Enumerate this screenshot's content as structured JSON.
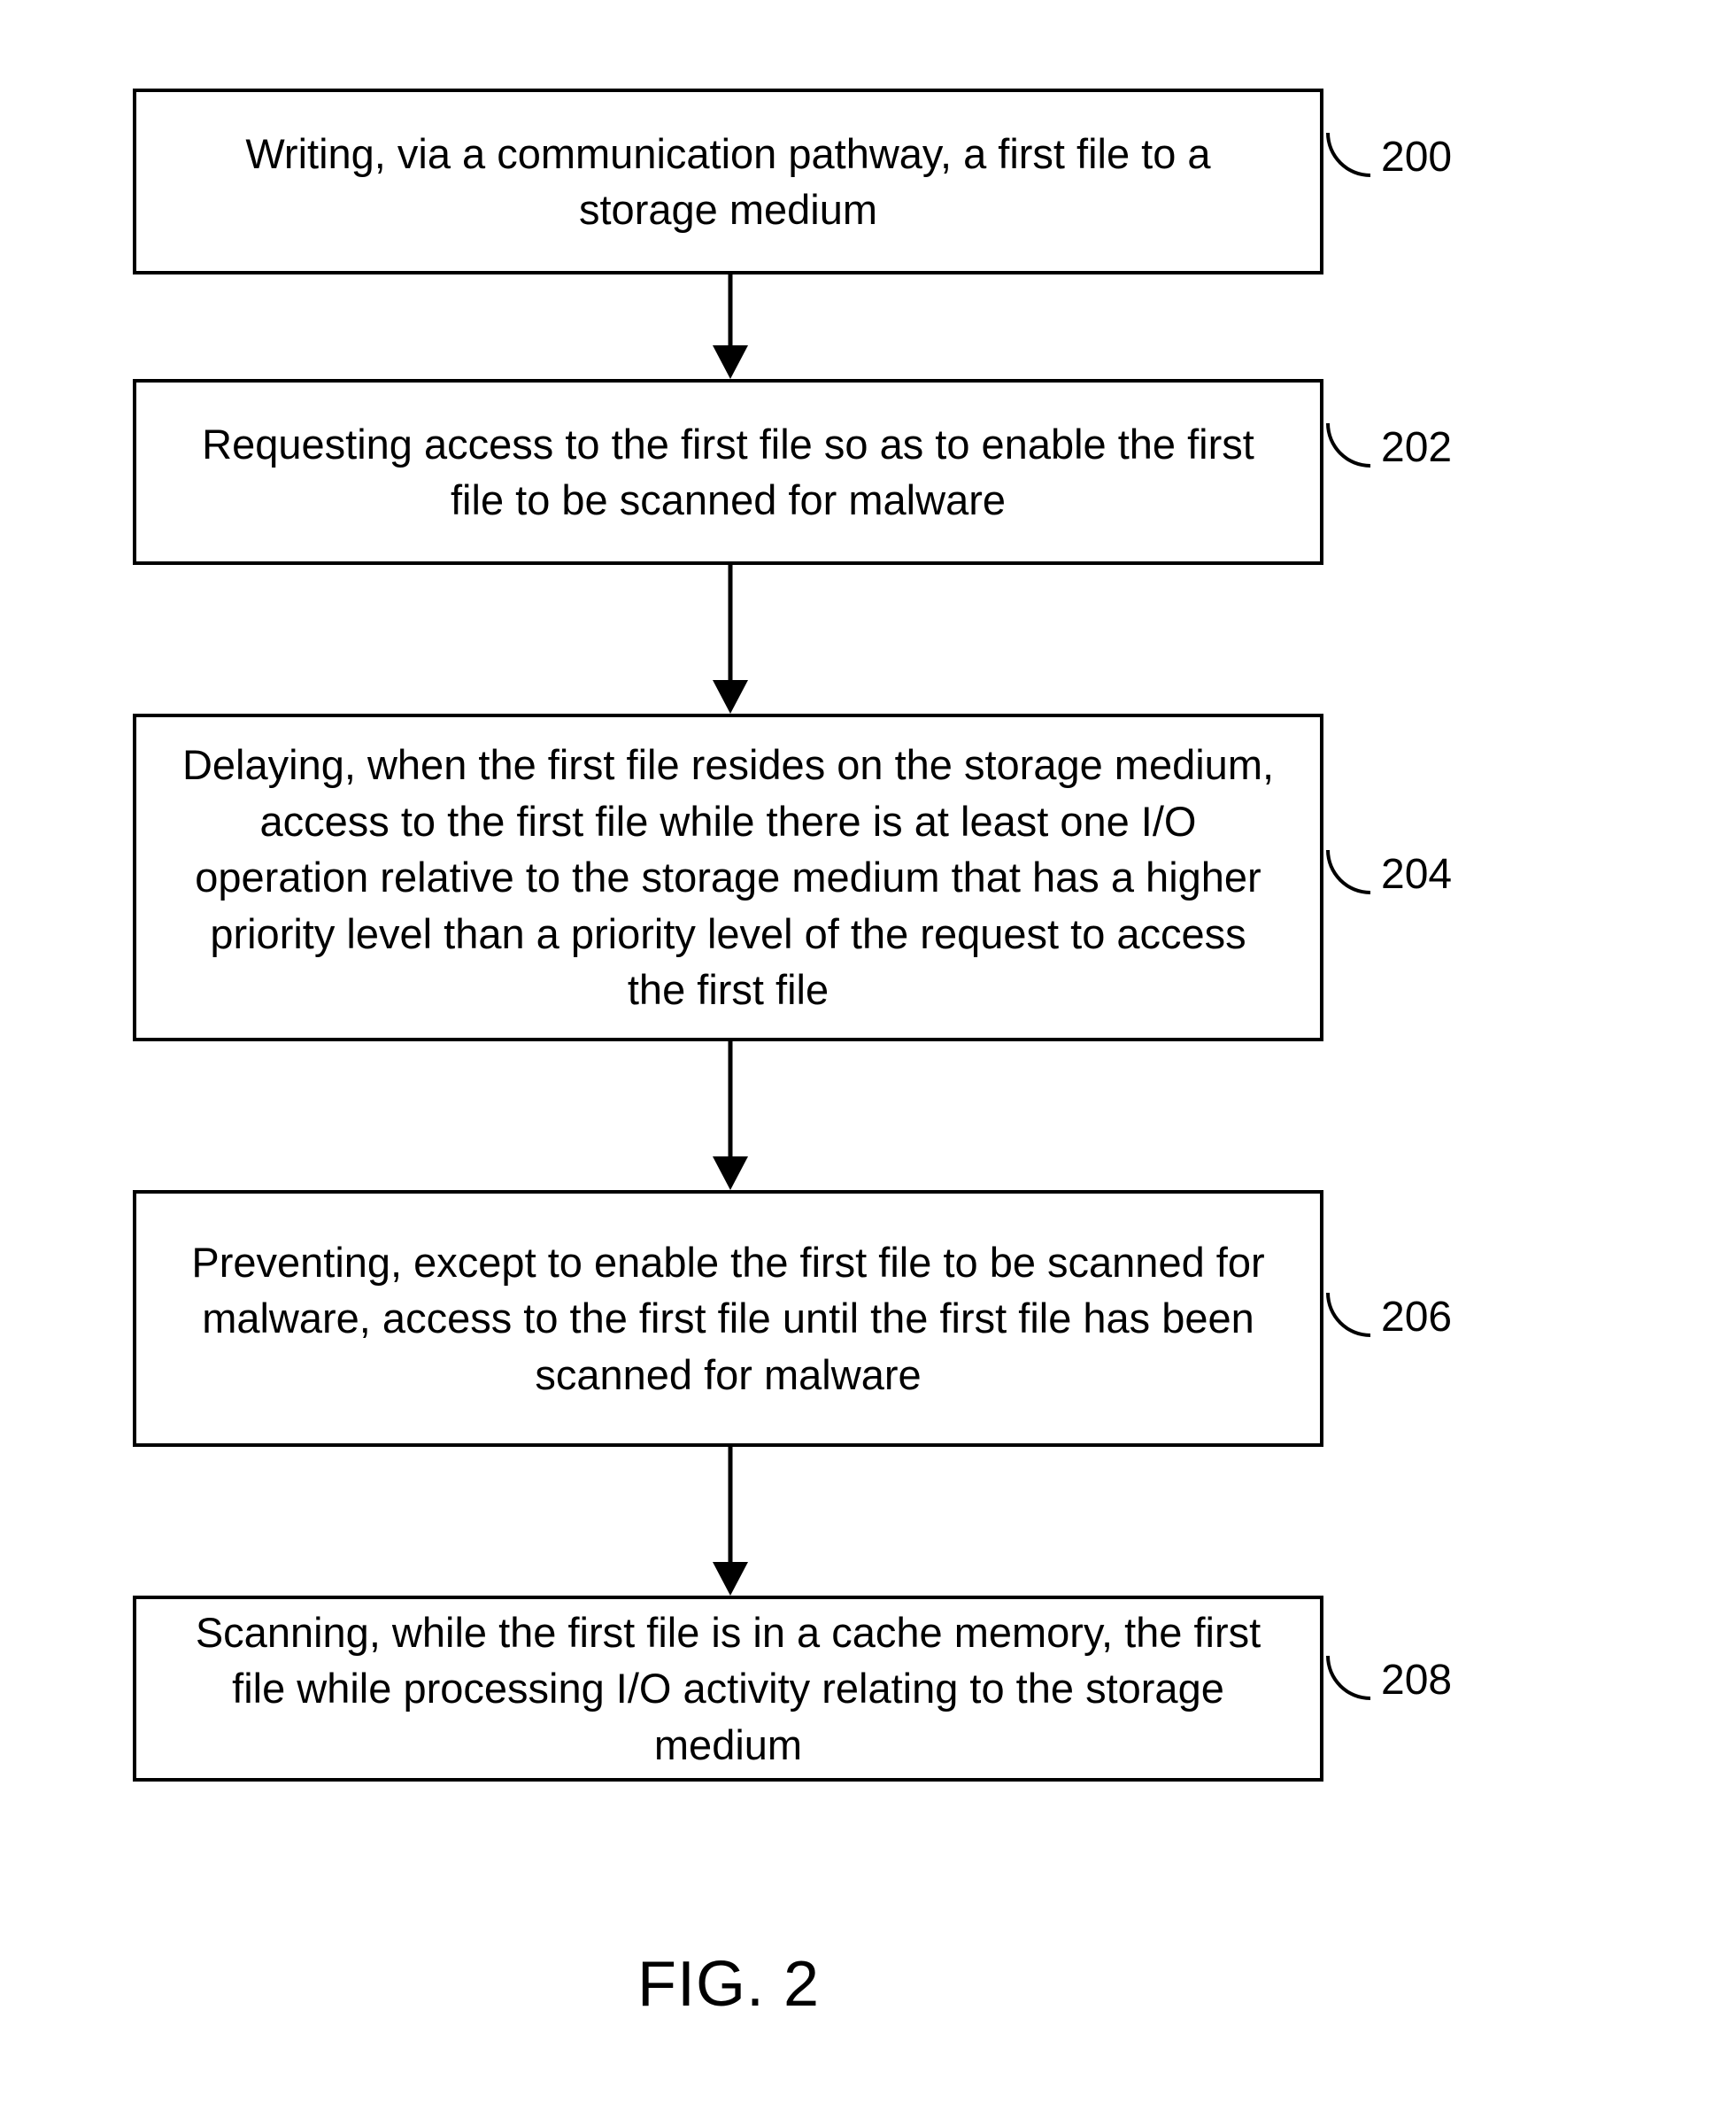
{
  "figure_label": "FIG. 2",
  "steps": [
    {
      "ref": "200",
      "text": "Writing, via a communication pathway, a first file to a storage medium"
    },
    {
      "ref": "202",
      "text": "Requesting access to the first file so as to enable the first file to be scanned for malware"
    },
    {
      "ref": "204",
      "text": "Delaying, when the first file resides on the storage medium, access to the first file while there is at least one I/O operation relative to the storage medium that has a higher priority level than a priority level of the request to access the first file"
    },
    {
      "ref": "206",
      "text": "Preventing, except to enable the first file to be scanned for malware, access to the first file until the first file has been scanned for malware"
    },
    {
      "ref": "208",
      "text": "Scanning, while the first file is in a cache memory, the first file while processing I/O activity relating to the storage medium"
    }
  ],
  "chart_data": {
    "type": "flowchart",
    "direction": "top-to-bottom",
    "nodes": [
      {
        "id": "200",
        "label": "Writing, via a communication pathway, a first file to a storage medium"
      },
      {
        "id": "202",
        "label": "Requesting access to the first file so as to enable the first file to be scanned for malware"
      },
      {
        "id": "204",
        "label": "Delaying, when the first file resides on the storage medium, access to the first file while there is at least one I/O operation relative to the storage medium that has a higher priority level than a priority level of the request to access the first file"
      },
      {
        "id": "206",
        "label": "Preventing, except to enable the first file to be scanned for malware, access to the first file until the first file has been scanned for malware"
      },
      {
        "id": "208",
        "label": "Scanning, while the first file is in a cache memory, the first file while processing I/O activity relating to the storage medium"
      }
    ],
    "edges": [
      {
        "from": "200",
        "to": "202"
      },
      {
        "from": "202",
        "to": "204"
      },
      {
        "from": "204",
        "to": "206"
      },
      {
        "from": "206",
        "to": "208"
      }
    ]
  }
}
